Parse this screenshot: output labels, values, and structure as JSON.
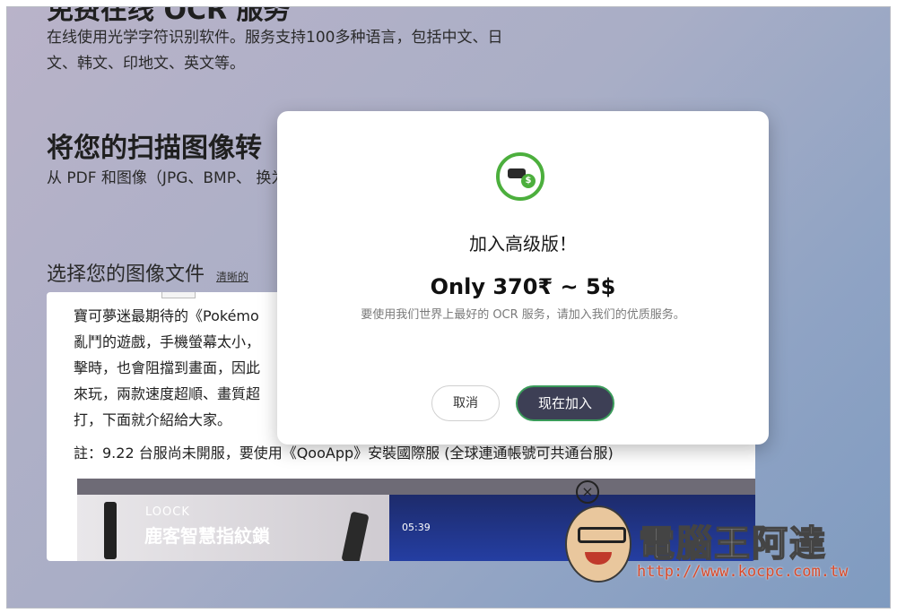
{
  "background_page": {
    "heading_top": "免费在线 OCR 服务",
    "intro_text": "在线使用光学字符识别软件。服务支持100多种语言，包括中文、日文、韩文、印地文、英文等。",
    "heading_convert": "将您的扫描图像转",
    "convert_text": "从 PDF 和图像（JPG、BMP、 换为可编辑的 Word、Excel 和",
    "choose_image_label": "选择您的图像文件",
    "choose_image_hint": "清晰的"
  },
  "article_card": {
    "paragraph_lines": [
      "寶可夢迷最期待的《Pokémo",
      "亂鬥的遊戲，手機螢幕太小，",
      "擊時，也會阻擋到畫面，因此",
      "來玩，兩款速度超順、畫質超",
      "打，下面就介紹給大家。"
    ],
    "note": "註：9.22 台服尚未開服，要使用《QooApp》安裝國際服 (全球連通帳號可共通台服)",
    "ad": {
      "brand": "LOOCK",
      "title": "鹿客智慧指紋鎖",
      "video_time": "05:39"
    }
  },
  "modal": {
    "icon": "hand-coin-icon",
    "title": "加入高级版！",
    "price": "Only 370₹ ~ 5$",
    "description": "要使用我们世界上最好的 OCR 服务，请加入我们的优质服务。",
    "cancel_label": "取消",
    "join_label": "现在加入",
    "accent_color": "#4caf3d",
    "join_button_color": "#3d3f55"
  },
  "watermark": {
    "site_name": "電腦王阿達",
    "url": "http://www.kocpc.com.tw"
  }
}
